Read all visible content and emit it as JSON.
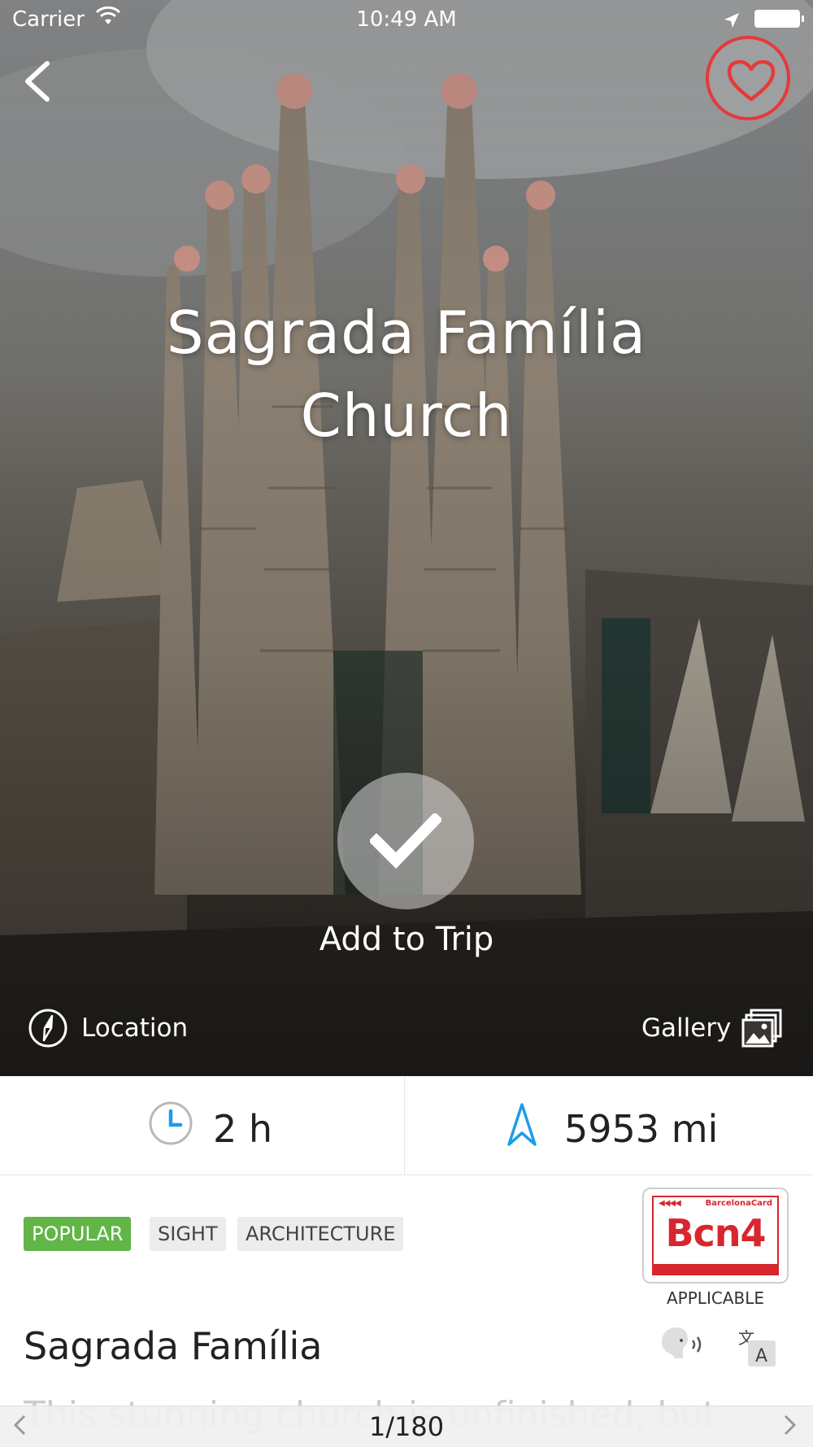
{
  "status_bar": {
    "carrier": "Carrier",
    "time": "10:49 AM"
  },
  "colors": {
    "accent_red": "#e6393b",
    "popular_green": "#62b547",
    "clock_blue": "#1e9be9"
  },
  "hero": {
    "title": "Sagrada Família Church",
    "add_to_trip_label": "Add to Trip",
    "location_label": "Location",
    "gallery_label": "Gallery"
  },
  "icons": {
    "back": "chevron-left-icon",
    "favorite": "heart-icon",
    "check": "checkmark-icon",
    "location": "compass-icon",
    "gallery": "gallery-icon",
    "duration": "clock-icon",
    "distance": "navigation-arrow-icon",
    "speak": "speaker-icon",
    "translate": "translate-icon"
  },
  "stats": {
    "duration": "2 h",
    "distance": "5953 mi"
  },
  "tags": [
    "POPULAR",
    "SIGHT",
    "ARCHITECTURE"
  ],
  "card": {
    "brand": "BarcelonaCard",
    "arrows": "◀◀◀◀",
    "name": "Bcn4",
    "status": "APPLICABLE"
  },
  "place_name": "Sagrada Família",
  "description_preview": "This stunning church is unfinished, but",
  "pager": {
    "label": "1/180"
  }
}
